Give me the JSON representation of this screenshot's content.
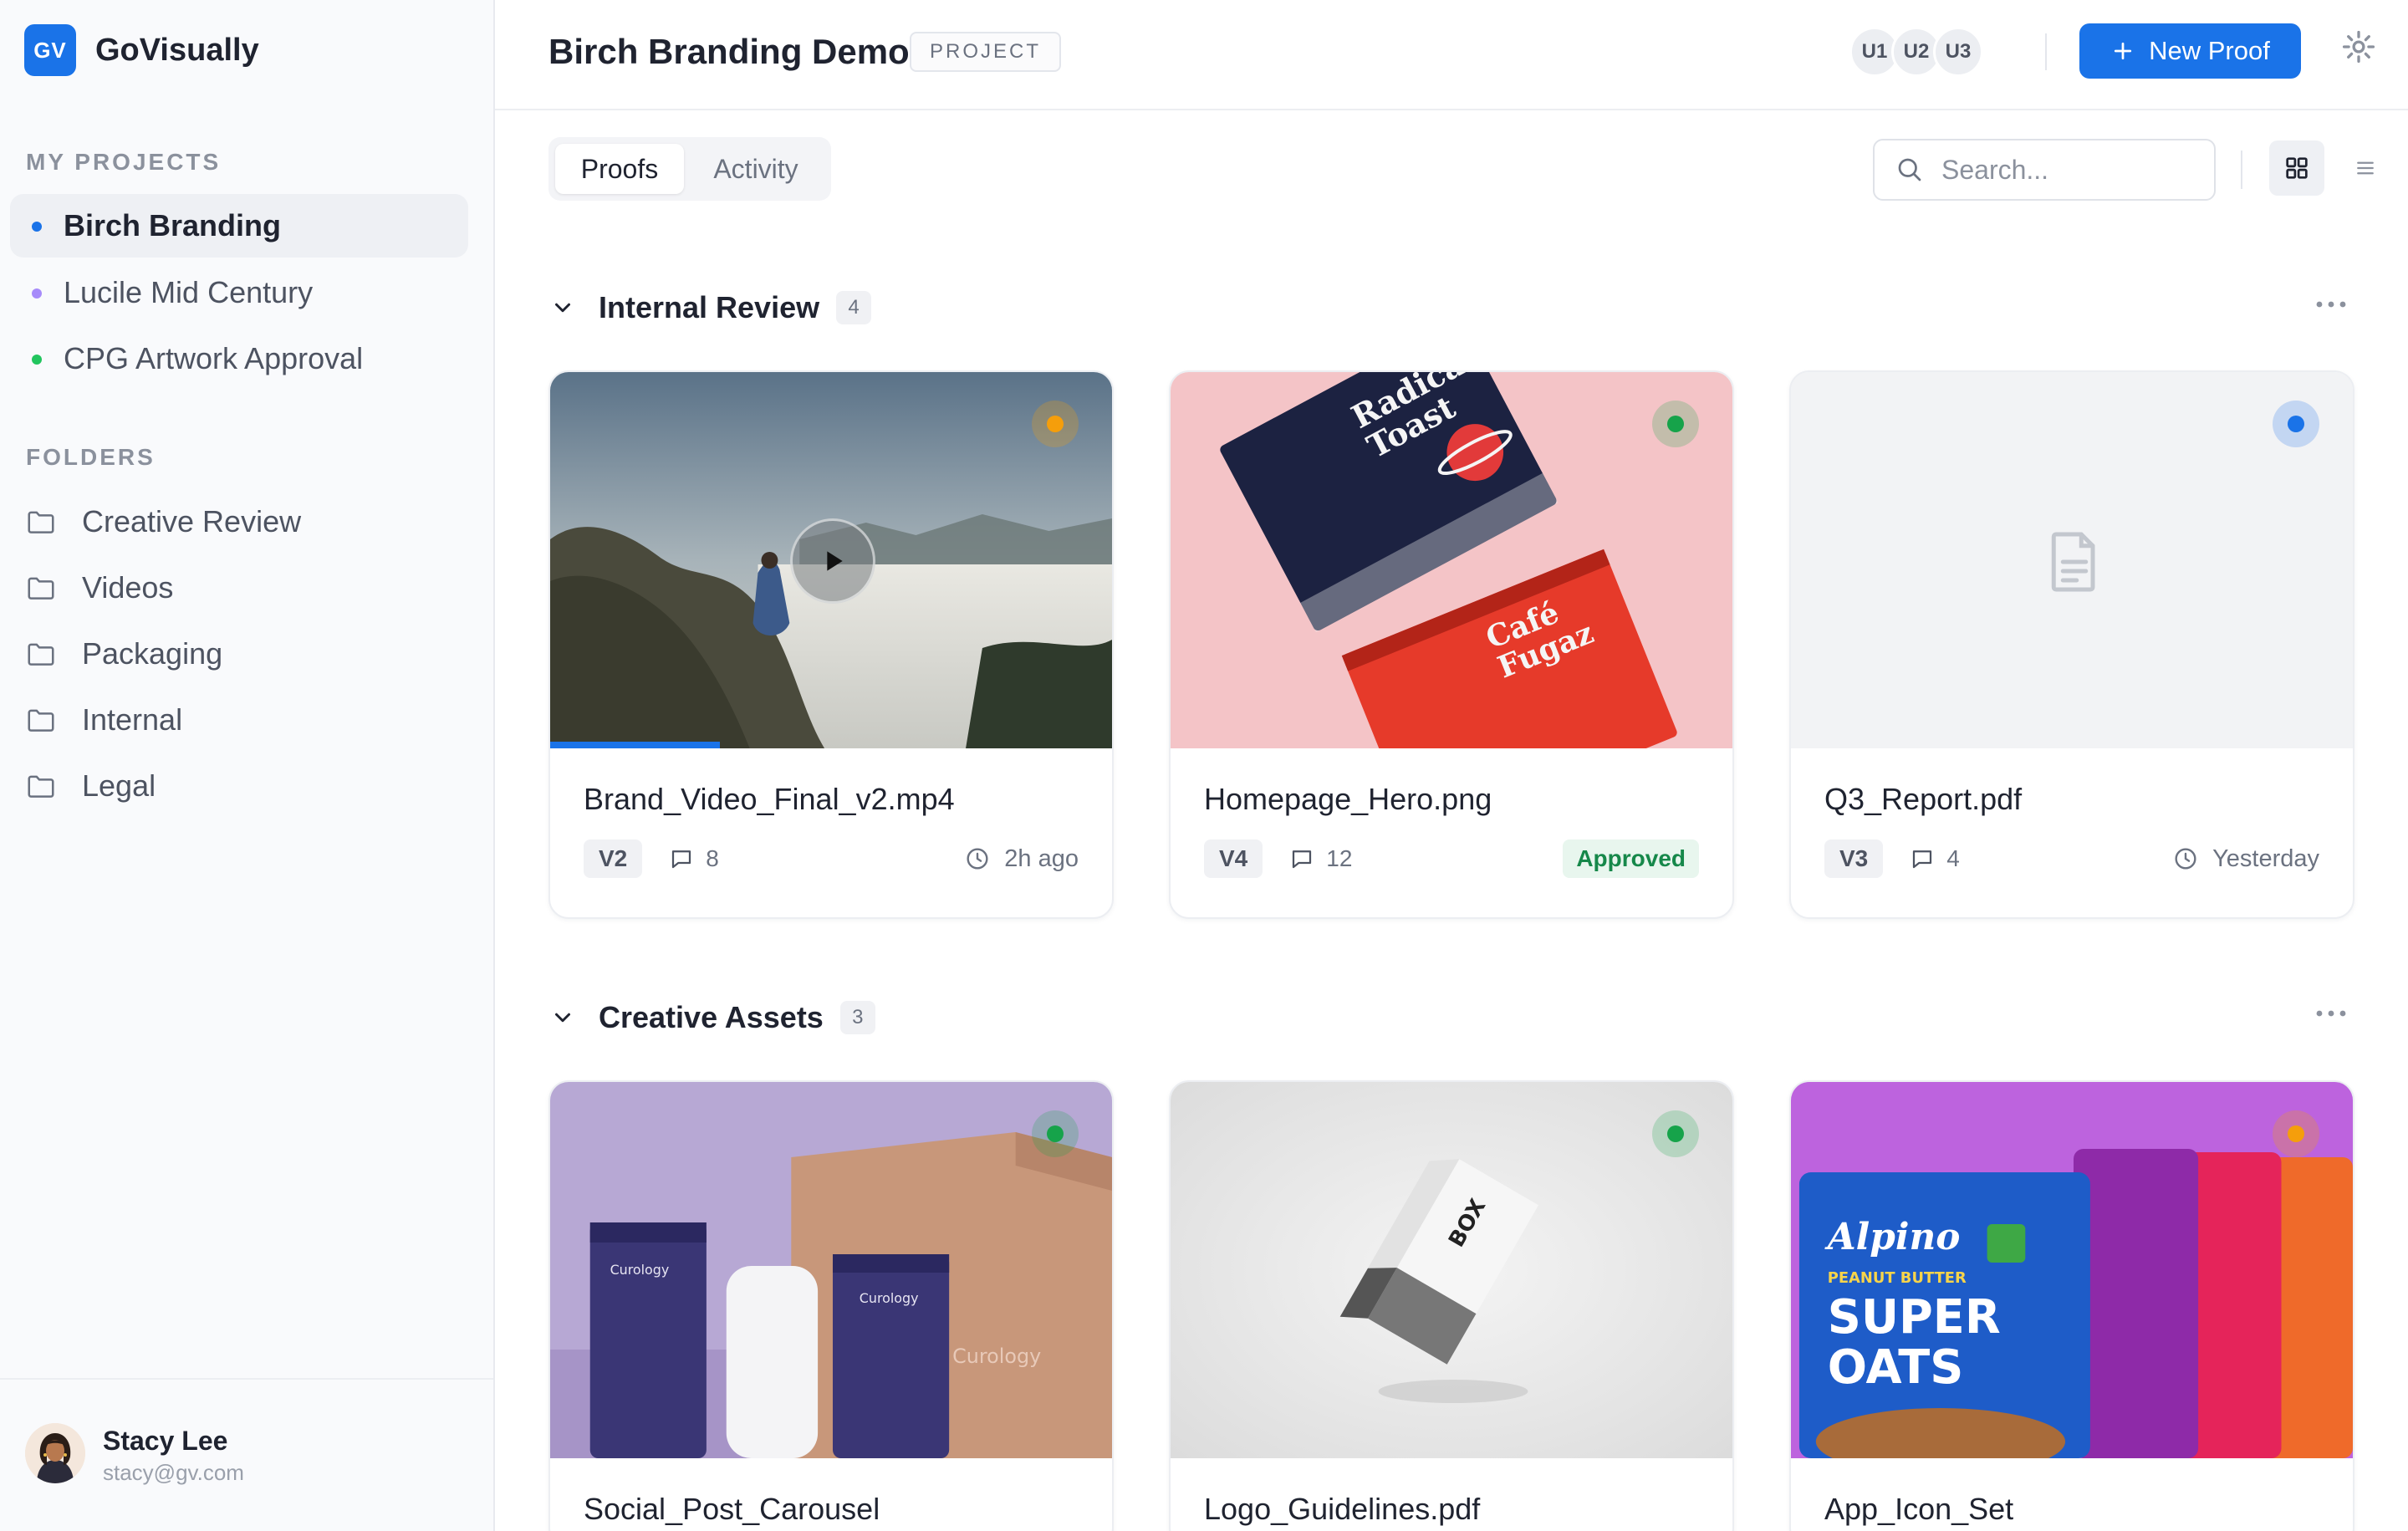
{
  "brand": {
    "logo": "GV",
    "name": "GoVisually"
  },
  "sidebar": {
    "projects_label": "MY PROJECTS",
    "projects": [
      {
        "label": "Birch Branding",
        "color": "#1a73e8",
        "active": true
      },
      {
        "label": "Lucile Mid Century",
        "color": "#a78bfa",
        "active": false
      },
      {
        "label": "CPG Artwork Approval",
        "color": "#22c55e",
        "active": false
      }
    ],
    "folders_label": "FOLDERS",
    "folders": [
      {
        "label": "Creative Review",
        "icon": "folder-icon"
      },
      {
        "label": "Videos",
        "icon": "folder-icon"
      },
      {
        "label": "Packaging",
        "icon": "folder-icon"
      },
      {
        "label": "Internal",
        "icon": "folder-icon"
      },
      {
        "label": "Legal",
        "icon": "folder-icon"
      }
    ],
    "user": {
      "name": "Stacy Lee",
      "email": "stacy@gv.com"
    }
  },
  "header": {
    "title": "Birch Branding Demo",
    "tag": "PROJECT",
    "collaborators": [
      "U1",
      "U2",
      "U3"
    ],
    "new_proof_label": "New Proof"
  },
  "toolbar": {
    "tabs": [
      {
        "label": "Proofs",
        "active": true
      },
      {
        "label": "Activity",
        "active": false
      }
    ],
    "search": {
      "placeholder": "Search...",
      "value": ""
    },
    "view_modes": [
      "grid-icon",
      "list-icon"
    ],
    "active_view": "grid"
  },
  "groups": [
    {
      "title": "Internal Review",
      "count": "4",
      "cards": [
        {
          "name": "Brand_Video_Final_v2.mp4",
          "version": "V2",
          "comments": "8",
          "right_text": "2h ago",
          "right_kind": "time",
          "status_color": "#f59e0b",
          "type": "video",
          "progress": 0.3
        },
        {
          "name": "Homepage_Hero.png",
          "version": "V4",
          "comments": "12",
          "right_text": "Approved",
          "right_kind": "badge",
          "status_color": "#16a34a",
          "type": "image"
        },
        {
          "name": "Q3_Report.pdf",
          "version": "V3",
          "comments": "4",
          "right_text": "Yesterday",
          "right_kind": "time",
          "status_color": "#1a73e8",
          "type": "document"
        }
      ]
    },
    {
      "title": "Creative Assets",
      "count": "3",
      "cards": [
        {
          "name": "Social_Post_Carousel",
          "status_color": "#16a34a",
          "type": "image"
        },
        {
          "name": "Logo_Guidelines.pdf",
          "status_color": "#16a34a",
          "type": "image"
        },
        {
          "name": "App_Icon_Set",
          "status_color": "#f59e0b",
          "type": "image"
        }
      ]
    }
  ],
  "packaging_text": {
    "radical": "Radical",
    "toast": "Toast",
    "cafe": "Café",
    "fugaz": "Fugaz",
    "curology": "Curology",
    "box": "BOX",
    "alpino": "Alpino",
    "super": "SUPER",
    "oats": "OATS",
    "peanut": "PEANUT BUTTER"
  }
}
